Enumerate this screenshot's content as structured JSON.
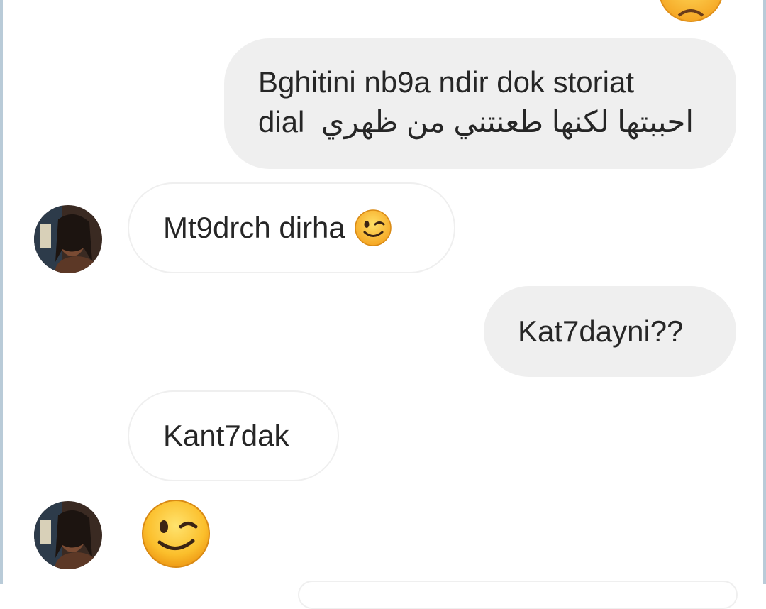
{
  "messages": [
    {
      "direction": "outgoing",
      "line1": "Bghitini nb9a ndir dok storiat",
      "line2_latin": "dial",
      "line2_arabic": "احببتها لكنها طعنتني من ظهري"
    },
    {
      "direction": "incoming",
      "text": "Mt9drch dirha",
      "emoji": "winking-face-emoji"
    },
    {
      "direction": "outgoing",
      "text": "Kat7dayni??"
    },
    {
      "direction": "incoming",
      "text": "Kant7dak"
    },
    {
      "direction": "incoming",
      "emoji": "winking-face-emoji"
    }
  ],
  "colors": {
    "outgoing_bubble": "#efefef",
    "incoming_border": "#efefef",
    "text": "#262626",
    "emoji_yellow": "#f7b928"
  }
}
